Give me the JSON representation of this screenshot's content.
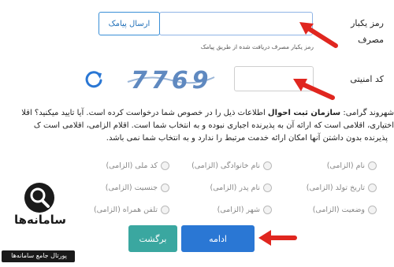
{
  "otp": {
    "label_line1": "رمز یکبار",
    "label_line2": "مصرف",
    "send_button": "ارسال پیامک",
    "hint": "رمز یکبار مصرف دریافت شده از طریق پیامک"
  },
  "captcha": {
    "label": "کد امنیتی",
    "image_text": "7769",
    "refresh_icon": "refresh-icon"
  },
  "consent": {
    "lines": [
      [
        "شهروند گرامی: ",
        "سازمان ثبت احوال",
        " اطلاعات ذیل را در خصوص شما درخواست کرده است. آیا تایید میکنید؟ اقلا"
      ],
      [
        "اختیاری، اقلامی است که ارائه آن به پذیرنده اجباری نبوده و به انتخاب شما است. اقلام الزامی، اقلامی است ک"
      ],
      [
        "پذیرنده بدون داشتن آنها امکان ارائه خدمت مرتبط را ندارد و به انتخاب شما نمی باشد."
      ]
    ]
  },
  "fields": [
    [
      "نام (الزامی)",
      "نام خانوادگی (الزامی)",
      "کد ملی (الزامی)"
    ],
    [
      "تاریخ تولد (الزامی)",
      "نام پدر (الزامی)",
      "جنسیت (الزامی)"
    ],
    [
      "وضعیت (الزامی)",
      "شهر (الزامی)",
      "تلفن همراه (الزامی)"
    ]
  ],
  "buttons": {
    "continue": "ادامه",
    "back": "برگشت"
  },
  "watermark": {
    "brand": "سامانه‌ها",
    "tagline": "پورتال جامع سامانه‌ها"
  },
  "colors": {
    "primary": "#2a77d4",
    "teal": "#3aa7a0",
    "arrow": "#e0261f"
  }
}
